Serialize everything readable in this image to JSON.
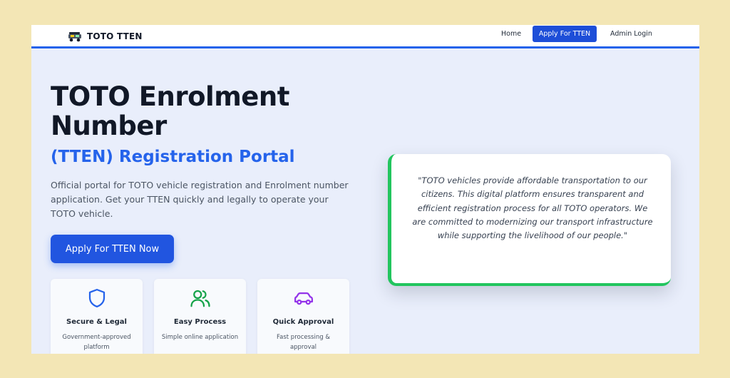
{
  "navbar": {
    "brand": "TOTO TTEN",
    "brand_icon": "auto-rickshaw-icon",
    "links": {
      "home": "Home",
      "apply": "Apply For TTEN",
      "admin": "Admin Login"
    }
  },
  "hero": {
    "title": "TOTO Enrolment Number",
    "subtitle": "(TTEN) Registration Portal",
    "description": "Official portal for TOTO vehicle registration and Enrolment number application. Get your TTEN quickly and legally to operate your TOTO vehicle.",
    "cta": "Apply For TTEN Now"
  },
  "features": [
    {
      "icon": "shield-icon",
      "title": "Secure & Legal",
      "description": "Government-approved platform",
      "color": "#2563eb"
    },
    {
      "icon": "users-icon",
      "title": "Easy Process",
      "description": "Simple online application",
      "color": "#16a34a"
    },
    {
      "icon": "car-icon",
      "title": "Quick Approval",
      "description": "Fast processing & approval",
      "color": "#9333ea"
    }
  ],
  "quote": {
    "text": "\"TOTO vehicles provide affordable transportation to our citizens. This digital platform ensures transparent and efficient registration process for all TOTO operators. We are committed to modernizing our transport infrastructure while supporting the livelihood of our people.\""
  },
  "colors": {
    "accent": "#2563eb",
    "quote_border": "#22c55e",
    "page_background": "#f3e6b5"
  }
}
